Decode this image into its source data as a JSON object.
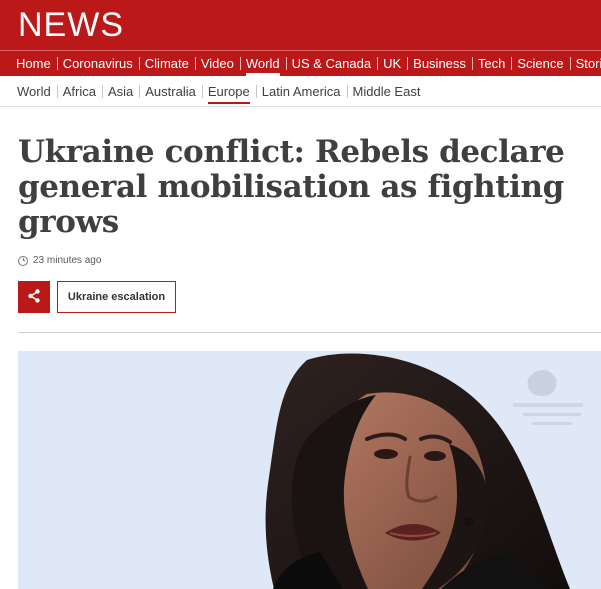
{
  "brand": "NEWS",
  "primary_nav": [
    "Home",
    "Coronavirus",
    "Climate",
    "Video",
    "World",
    "US & Canada",
    "UK",
    "Business",
    "Tech",
    "Science",
    "Stories"
  ],
  "secondary_nav": [
    "World",
    "Africa",
    "Asia",
    "Australia",
    "Europe",
    "Latin America",
    "Middle East"
  ],
  "article": {
    "headline": "Ukraine conflict: Rebels declare general mobilisation as fighting grows",
    "timestamp": "23 minutes ago",
    "tag": "Ukraine escalation"
  },
  "colors": {
    "brand_red": "#bb1919",
    "headline": "#3f3f42"
  },
  "icons": {
    "share": "share-icon",
    "clock": "clock-icon"
  }
}
